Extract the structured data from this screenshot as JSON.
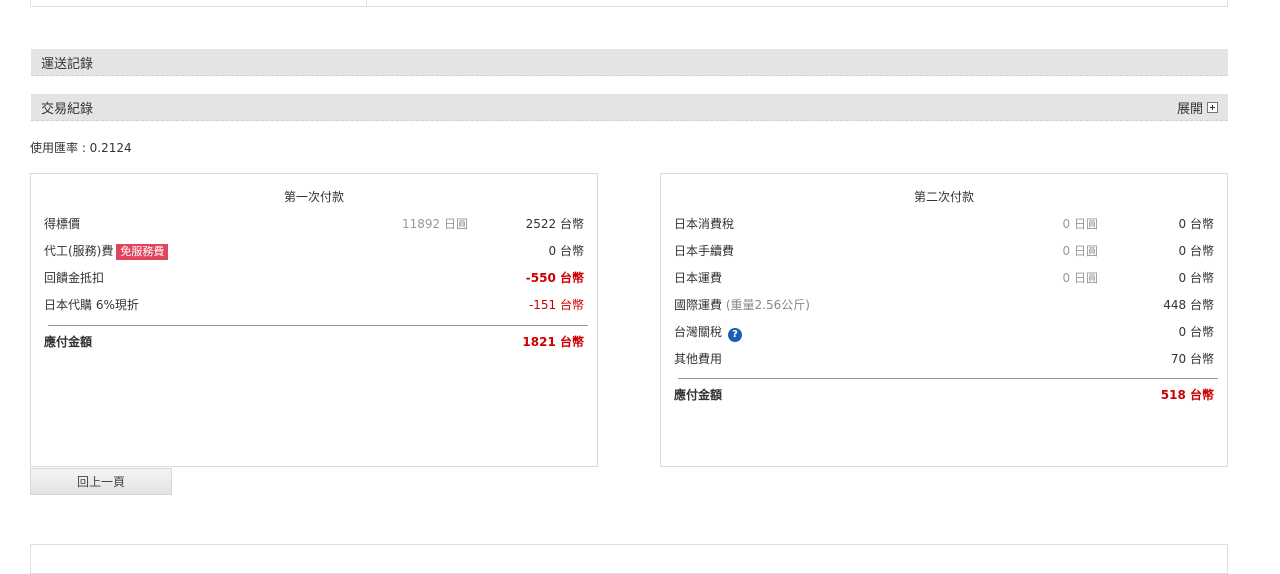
{
  "sections": {
    "shipping_label": "運送記錄",
    "trade_label": "交易紀錄",
    "expand_label": "展開"
  },
  "rate": "使用匯率 : 0.2124",
  "first_payment": {
    "title": "第一次付款",
    "rows": [
      {
        "label": "得標價",
        "jpy": "11892 日圓",
        "twd": "2522 台幣"
      },
      {
        "label": "代工(服務)費",
        "badge": "免服務費",
        "twd": "0 台幣"
      },
      {
        "label": "回饋金抵扣",
        "twd": "-550 台幣"
      },
      {
        "label": "日本代購 6%現折",
        "twd": "-151 台幣"
      }
    ],
    "total_label": "應付金額",
    "total_value": "1821 台幣"
  },
  "second_payment": {
    "title": "第二次付款",
    "rows": [
      {
        "label": "日本消費稅",
        "jpy": "0 日圓",
        "twd": "0 台幣"
      },
      {
        "label": "日本手續費",
        "jpy": "0 日圓",
        "twd": "0 台幣"
      },
      {
        "label": "日本運費",
        "jpy": "0 日圓",
        "twd": "0 台幣"
      },
      {
        "label": "國際運費",
        "sub": "(重量2.56公斤)",
        "twd": "448 台幣"
      },
      {
        "label": "台灣關稅",
        "help": "?",
        "twd": "0 台幣"
      },
      {
        "label": "其他費用",
        "twd": "70 台幣"
      }
    ],
    "total_label": "應付金額",
    "total_value": "518 台幣"
  },
  "back_button": "回上一頁",
  "colors": {
    "accent_red": "#cc0000",
    "badge": "#e0455e",
    "help": "#1a5fb4"
  }
}
